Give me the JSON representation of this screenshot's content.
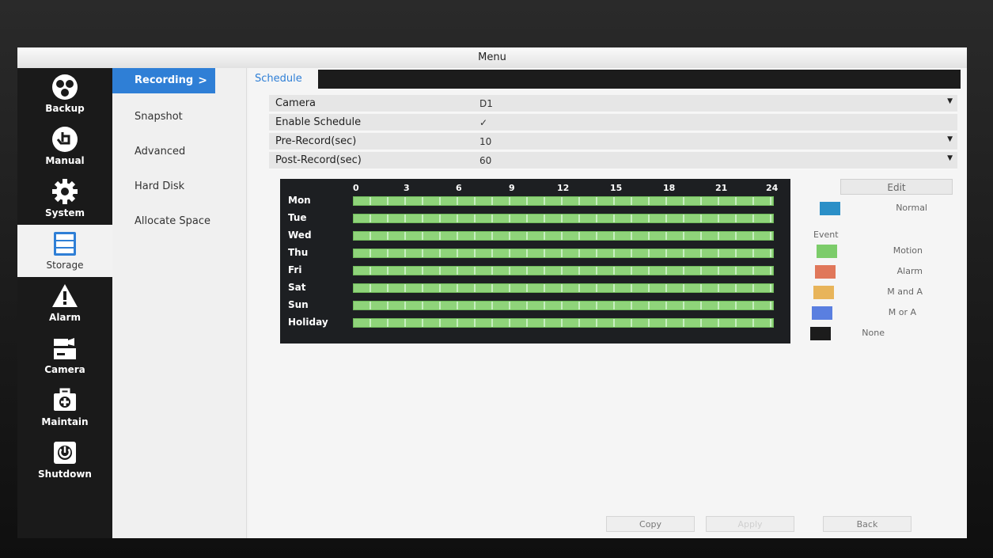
{
  "window": {
    "title": "Menu"
  },
  "nav": {
    "items": [
      {
        "label": "Backup",
        "icon": "backup-icon"
      },
      {
        "label": "Manual",
        "icon": "manual-icon"
      },
      {
        "label": "System",
        "icon": "gear-icon"
      },
      {
        "label": "Storage",
        "icon": "storage-icon",
        "active": true
      },
      {
        "label": "Alarm",
        "icon": "alarm-icon"
      },
      {
        "label": "Camera",
        "icon": "camera-icon"
      },
      {
        "label": "Maintain",
        "icon": "maintain-icon"
      },
      {
        "label": "Shutdown",
        "icon": "power-icon"
      }
    ]
  },
  "submenu": {
    "items": [
      {
        "label": "Recording",
        "active": true,
        "arrow": ">"
      },
      {
        "label": "Snapshot"
      },
      {
        "label": "Advanced"
      },
      {
        "label": "Hard Disk"
      },
      {
        "label": "Allocate Space"
      }
    ]
  },
  "tabs": [
    {
      "label": "Schedule",
      "active": true
    }
  ],
  "form": {
    "camera": {
      "label": "Camera",
      "value": "D1"
    },
    "enable_schedule": {
      "label": "Enable Schedule",
      "checked": true,
      "mark": "✓"
    },
    "pre_record": {
      "label": "Pre-Record(sec)",
      "value": "10"
    },
    "post_record": {
      "label": "Post-Record(sec)",
      "value": "60"
    }
  },
  "schedule": {
    "hours": [
      "0",
      "3",
      "6",
      "9",
      "12",
      "15",
      "18",
      "21",
      "24"
    ],
    "days": [
      "Mon",
      "Tue",
      "Wed",
      "Thu",
      "Fri",
      "Sat",
      "Sun",
      "Holiday"
    ],
    "fill_type": "Motion",
    "fill_color": "#8fd47a"
  },
  "legend": {
    "edit_label": "Edit",
    "normal": {
      "label": "Normal",
      "color": "#2b8fc7"
    },
    "event_label": "Event",
    "events": [
      {
        "label": "Motion",
        "color": "#7ccc6a"
      },
      {
        "label": "Alarm",
        "color": "#e0775a"
      },
      {
        "label": "M and A",
        "color": "#e8b45a"
      },
      {
        "label": "M or A",
        "color": "#5a7fe0"
      },
      {
        "label": "None",
        "color": "#1c1c1c"
      }
    ]
  },
  "buttons": {
    "copy": "Copy",
    "apply": "Apply",
    "back": "Back"
  }
}
